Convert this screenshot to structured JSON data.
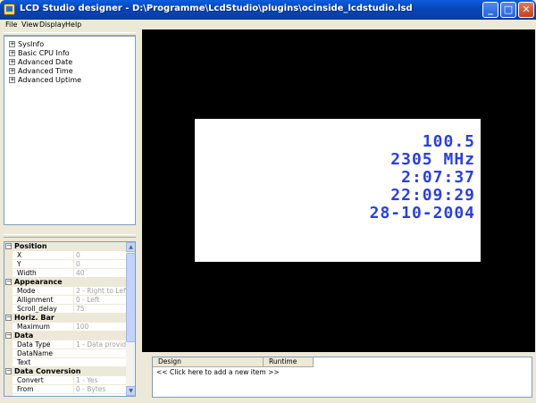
{
  "window": {
    "title": "LCD Studio designer  - D:\\Programme\\LcdStudio\\plugins\\ocinside_lcdstudio.lsd",
    "minimize_glyph": "_",
    "maximize_glyph": "□",
    "close_glyph": "✕"
  },
  "menu": {
    "file": "File",
    "view": "View",
    "display": "Display",
    "help": "Help"
  },
  "tree": {
    "items": [
      {
        "label": "SysInfo"
      },
      {
        "label": "Basic CPU Info"
      },
      {
        "label": "Advanced Date"
      },
      {
        "label": "Advanced Time"
      },
      {
        "label": "Advanced Uptime"
      }
    ],
    "expand_glyph": "+"
  },
  "properties": {
    "collapse_glyph": "−",
    "rows": [
      {
        "kind": "category",
        "name": "Position"
      },
      {
        "kind": "prop",
        "name": "X",
        "value": "0"
      },
      {
        "kind": "prop",
        "name": "Y",
        "value": "0"
      },
      {
        "kind": "prop",
        "name": "Width",
        "value": "40"
      },
      {
        "kind": "category",
        "name": "Appearance"
      },
      {
        "kind": "prop",
        "name": "Mode",
        "value": "2 - Right to Left"
      },
      {
        "kind": "prop",
        "name": "Allignment",
        "value": "0 - Left"
      },
      {
        "kind": "prop",
        "name": "Scroll_delay",
        "value": "75"
      },
      {
        "kind": "category",
        "name": "Horiz. Bar"
      },
      {
        "kind": "prop",
        "name": "Maximum",
        "value": "100"
      },
      {
        "kind": "category",
        "name": "Data"
      },
      {
        "kind": "prop",
        "name": "Data Type",
        "value": "1 - Data provider"
      },
      {
        "kind": "prop",
        "name": "DataName",
        "value": ""
      },
      {
        "kind": "prop",
        "name": "Text",
        "value": ""
      },
      {
        "kind": "category",
        "name": "Data Conversion"
      },
      {
        "kind": "prop",
        "name": "Convert",
        "value": "1 - Yes"
      },
      {
        "kind": "prop",
        "name": "From",
        "value": "0 - Bytes"
      }
    ]
  },
  "lcd": {
    "lines": [
      "100.5",
      "2305 MHz",
      "2:07:37",
      "22:09:29",
      "28-10-2004"
    ],
    "text_color": "#2a3fe0",
    "screen_color": "#ffffff"
  },
  "list": {
    "headers": [
      "Design",
      "Runtime"
    ],
    "rows": [
      "<< Click here to add a new item >>"
    ]
  }
}
